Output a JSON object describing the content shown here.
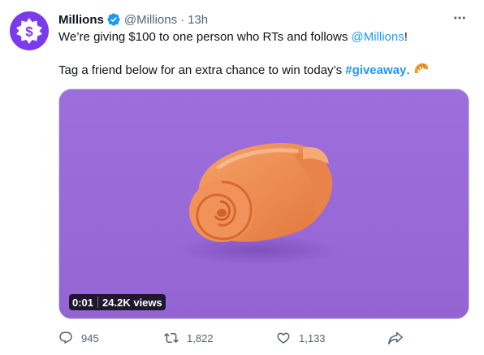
{
  "author": {
    "name": "Millions",
    "handle": "@Millions",
    "separator": "·",
    "time": "13h",
    "avatar_icon": "dollar-badge-icon",
    "verified_icon": "verified-badge-icon",
    "accent": "#7c3aed"
  },
  "tweet": {
    "line1_prefix": "We’re giving $100 to one person who RTs and follows ",
    "line1_mention": "@Millions",
    "line1_suffix": "!",
    "line2_prefix": "Tag a friend below for an extra chance to win today’s ",
    "line2_hashtag": "#giveaway",
    "line2_suffix": ".",
    "emoji": "croissant-icon"
  },
  "media": {
    "type": "video",
    "elapsed": "0:01",
    "views": "24.2K views",
    "background": "#9a6bd8"
  },
  "actions": {
    "replies": "945",
    "retweets": "1,822",
    "likes": "1,133",
    "share_icon": "share-icon"
  },
  "colors": {
    "text": "#0f1419",
    "muted": "#536471",
    "link": "#1d9bf0",
    "verified": "#1d9bf0"
  }
}
